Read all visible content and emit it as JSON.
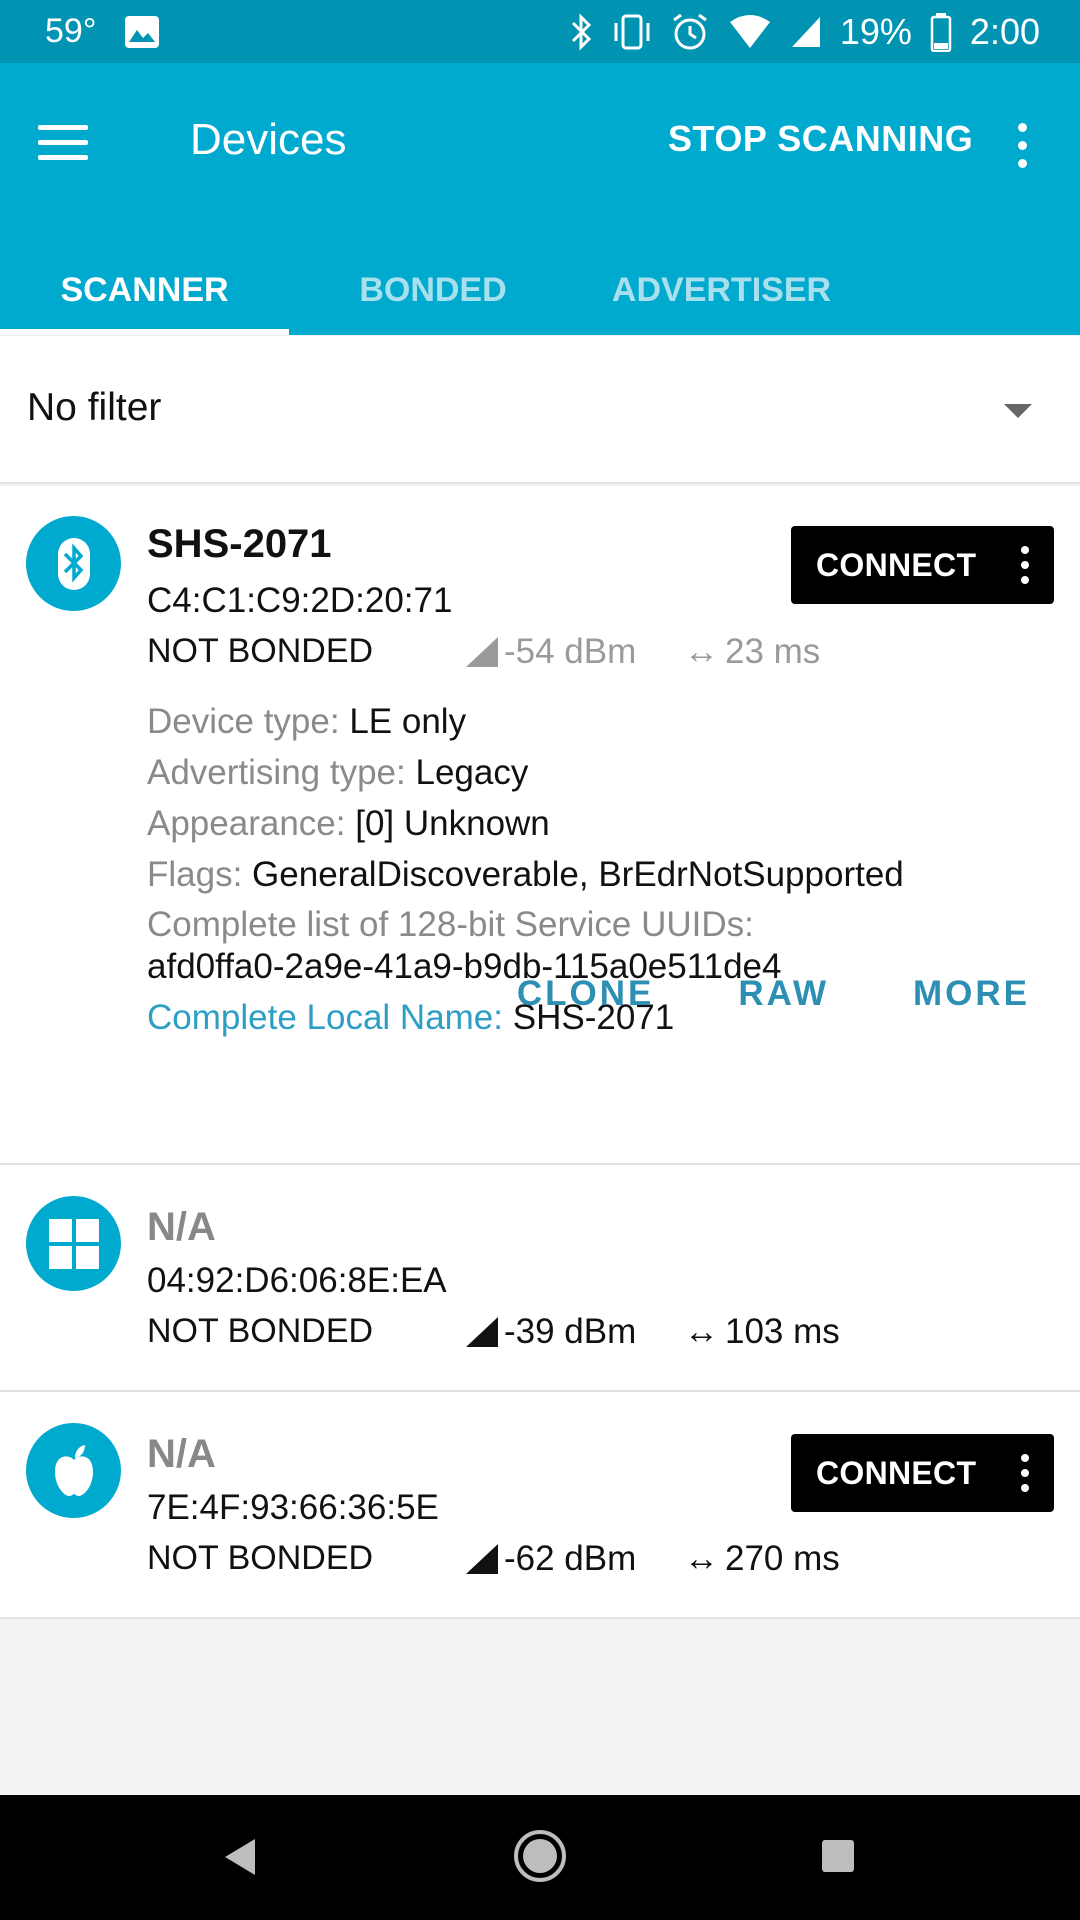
{
  "status_bar": {
    "temperature": "59°",
    "battery": "19%",
    "time": "2:00"
  },
  "app_bar": {
    "title": "Devices",
    "stop_scanning": "STOP SCANNING"
  },
  "tabs": [
    {
      "label": "SCANNER",
      "active": true
    },
    {
      "label": "BONDED",
      "active": false
    },
    {
      "label": "ADVERTISER",
      "active": false
    }
  ],
  "filter": {
    "label": "No filter"
  },
  "devices": [
    {
      "name": "SHS-2071",
      "mac": "C4:C1:C9:2D:20:71",
      "bond": "NOT BONDED",
      "rssi": "-54 dBm",
      "interval": "23 ms",
      "icon": "bluetooth-icon",
      "connect_label": "CONNECT",
      "details": {
        "device_type_key": "Device type:",
        "device_type_val": "LE only",
        "adv_type_key": "Advertising type:",
        "adv_type_val": "Legacy",
        "appearance_key": "Appearance:",
        "appearance_val": "[0] Unknown",
        "flags_key": "Flags:",
        "flags_val": "GeneralDiscoverable, BrEdrNotSupported",
        "uuids_key": "Complete list of 128-bit Service UUIDs:",
        "uuids_val": "afd0ffa0-2a9e-41a9-b9db-115a0e511de4",
        "local_name_key": "Complete Local Name:",
        "local_name_val": "SHS-2071"
      },
      "actions": [
        "CLONE",
        "RAW",
        "MORE"
      ]
    },
    {
      "name": "N/A",
      "mac": "04:92:D6:06:8E:EA",
      "bond": "NOT BONDED",
      "rssi": "-39 dBm",
      "interval": "103 ms",
      "icon": "windows-icon"
    },
    {
      "name": "N/A",
      "mac": "7E:4F:93:66:36:5E",
      "bond": "NOT BONDED",
      "rssi": "-62 dBm",
      "interval": "270 ms",
      "icon": "apple-icon",
      "connect_label": "CONNECT"
    }
  ],
  "colors": {
    "status_bar": "#0094b2",
    "app_bar": "#00a9ce",
    "accent": "#2d8fb3"
  }
}
